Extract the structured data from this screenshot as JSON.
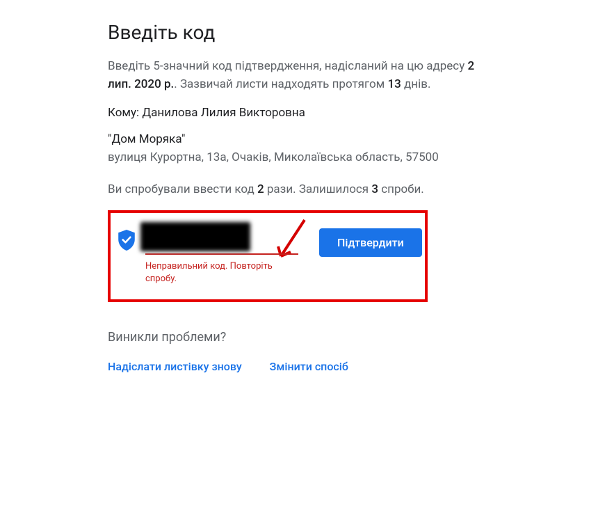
{
  "heading": "Введіть код",
  "desc": {
    "pre": "Введіть 5-значний код підтвердження, надісланий на цю адресу ",
    "date": "2 лип. 2020 р.",
    "mid": ". Зазвичай листи надходять протягом ",
    "days": "13",
    "post": " днів."
  },
  "recipient_label": "Кому: ",
  "recipient_name": "Данилова Лилия Викторовна",
  "business_name": "\"Дом Моряка\"",
  "address": "вулиця Курортна, 13а, Очаків, Миколаївська область, 57500",
  "attempts": {
    "pre": "Ви спробували ввести код ",
    "used": "2",
    "mid": " рази. Залишилося ",
    "left": "3",
    "post": " спроби."
  },
  "code_value": "",
  "error_message": "Неправильний код. Повторіть спробу.",
  "confirm_label": "Підтвердити",
  "problems_heading": "Виникли проблеми?",
  "link_resend": "Надіслати листівку знову",
  "link_change": "Змінити спосіб"
}
